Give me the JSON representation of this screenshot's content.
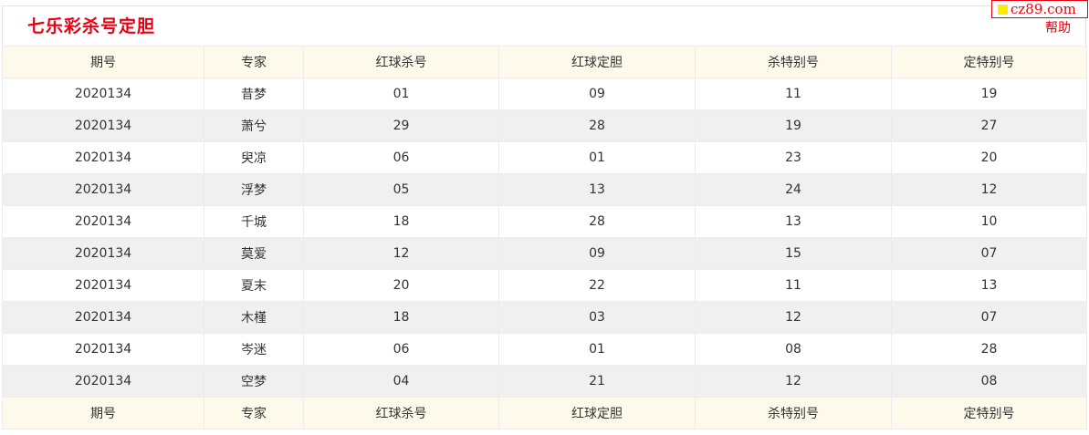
{
  "page": {
    "title": "七乐彩杀号定胆"
  },
  "logo": {
    "text": "cz89.com"
  },
  "help": {
    "label": "帮助"
  },
  "table": {
    "headers": [
      "期号",
      "专家",
      "红球杀号",
      "红球定胆",
      "杀特别号",
      "定特别号"
    ],
    "rows": [
      [
        "2020134",
        "昔梦",
        "01",
        "09",
        "11",
        "19"
      ],
      [
        "2020134",
        "萧兮",
        "29",
        "28",
        "19",
        "27"
      ],
      [
        "2020134",
        "臾凉",
        "06",
        "01",
        "23",
        "20"
      ],
      [
        "2020134",
        "浮梦",
        "05",
        "13",
        "24",
        "12"
      ],
      [
        "2020134",
        "千城",
        "18",
        "28",
        "13",
        "10"
      ],
      [
        "2020134",
        "莫爱",
        "12",
        "09",
        "15",
        "07"
      ],
      [
        "2020134",
        "夏末",
        "20",
        "22",
        "11",
        "13"
      ],
      [
        "2020134",
        "木槿",
        "18",
        "03",
        "12",
        "07"
      ],
      [
        "2020134",
        "岑迷",
        "06",
        "01",
        "08",
        "28"
      ],
      [
        "2020134",
        "空梦",
        "04",
        "21",
        "12",
        "08"
      ]
    ]
  },
  "colors": {
    "accent": "#e60012",
    "header_bg": "#fdf9eb",
    "stripe_bg": "#f0f0f0",
    "logo_square": "#ffea00"
  }
}
